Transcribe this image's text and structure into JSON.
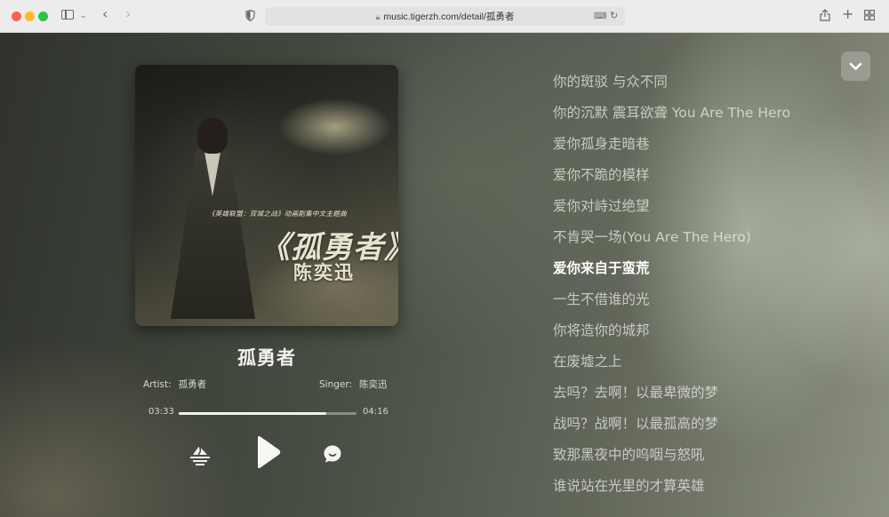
{
  "browser": {
    "url": "music.tigerzh.com/detail/孤勇者"
  },
  "cover": {
    "subtitle": "《英雄联盟：双城之战》动画剧集中文主题曲",
    "title": "《孤勇者》",
    "artist": "陈奕迅"
  },
  "song": {
    "title": "孤勇者",
    "artist_label": "Artist:",
    "artist": "孤勇者",
    "singer_label": "Singer:",
    "singer": "陈奕迅"
  },
  "progress": {
    "current": "03:33",
    "total": "04:16",
    "fraction": 0.83
  },
  "lyrics": {
    "active_index": 6,
    "lines": [
      "你的斑驳 与众不同",
      "你的沉默 震耳欲聋 You Are The Hero",
      "爱你孤身走暗巷",
      "爱你不跪的模样",
      "爱你对峙过绝望",
      "不肯哭一场(You Are The Hero)",
      "爱你来自于蛮荒",
      "一生不借谁的光",
      "你将造你的城邦",
      "在废墟之上",
      "去吗？去啊！以最卑微的梦",
      "战吗？战啊！以最孤高的梦",
      "致那黑夜中的呜咽与怒吼",
      "谁说站在光里的才算英雄"
    ]
  },
  "icons": {
    "mode": "play-mode-icon",
    "play": "play-icon",
    "comment": "comment-icon",
    "collapse": "chevron-down-icon"
  }
}
